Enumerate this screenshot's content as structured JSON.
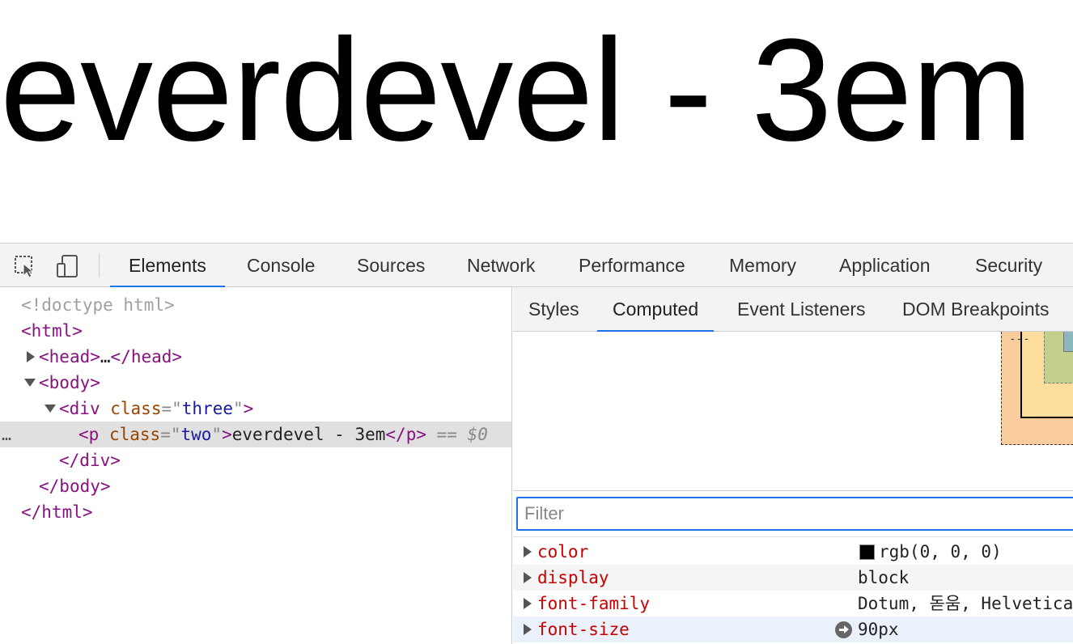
{
  "page": {
    "heading": "everdevel - 3em"
  },
  "devtools": {
    "tabs": [
      "Elements",
      "Console",
      "Sources",
      "Network",
      "Performance",
      "Memory",
      "Application",
      "Security"
    ],
    "active_tab": "Elements",
    "toolbar_icons": [
      "inspect-element-icon",
      "device-toggle-icon"
    ],
    "dom": {
      "doctype": "<!doctype html>",
      "html_open": "html",
      "head_tag": "head",
      "head_ellipsis": "…",
      "body_tag": "body",
      "div_tag": "div",
      "div_attr_name": "class",
      "div_attr_value": "three",
      "p_tag": "p",
      "p_attr_name": "class",
      "p_attr_value": "two",
      "p_text": "everdevel - 3em",
      "selected_marker": "==",
      "selected_var": "$0",
      "row_menu": "…"
    },
    "side_tabs": [
      "Styles",
      "Computed",
      "Event Listeners",
      "DOM Breakpoints"
    ],
    "active_side_tab": "Computed",
    "box_model_dashes": "- - -",
    "filter": {
      "placeholder": "Filter",
      "value": ""
    },
    "computed": [
      {
        "name": "color",
        "value": "rgb(0, 0, 0)",
        "swatch": "#000000"
      },
      {
        "name": "display",
        "value": "block"
      },
      {
        "name": "font-family",
        "value": "Dotum, 돋움, Helvetica"
      },
      {
        "name": "font-size",
        "value": "90px",
        "goto_icon": "arrow-right-circle-icon"
      }
    ],
    "colors": {
      "accent": "#1a73e8",
      "tag": "#881280",
      "attr_name": "#994500",
      "attr_value": "#1a1aa6",
      "prop_name": "#c80000"
    }
  }
}
